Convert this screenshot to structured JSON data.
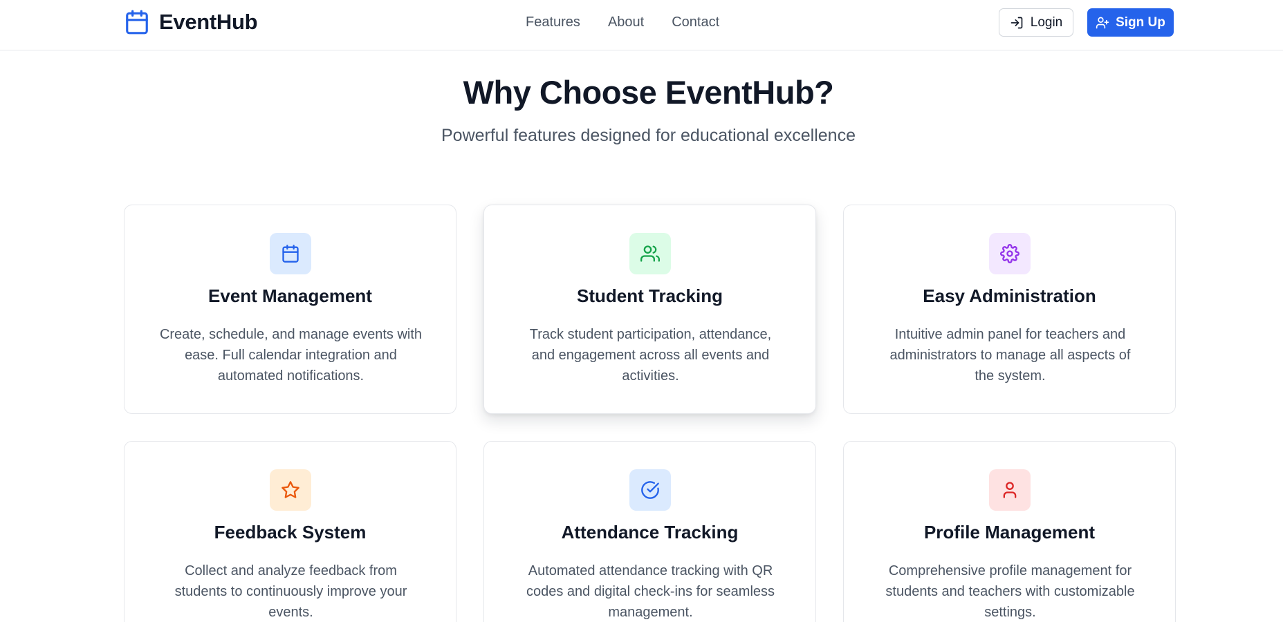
{
  "nav": {
    "brand": "EventHub",
    "links": [
      "Features",
      "About",
      "Contact"
    ],
    "login_label": "Login",
    "signup_label": "Sign Up"
  },
  "hero": {
    "title": "Why Choose EventHub?",
    "subtitle": "Powerful features designed for educational excellence"
  },
  "colors": {
    "primary": "#2563eb",
    "text": "#111827",
    "muted": "#4b5563"
  },
  "features": [
    {
      "title": "Event Management",
      "description": "Create, schedule, and manage events with ease. Full calendar integration and automated notifications.",
      "icon": "calendar-icon",
      "icon_color": "#2563eb",
      "icon_bg": "#dbeafe"
    },
    {
      "title": "Student Tracking",
      "description": "Track student participation, attendance, and engagement across all events and activities.",
      "icon": "users-icon",
      "icon_color": "#16a34a",
      "icon_bg": "#dcfce7"
    },
    {
      "title": "Easy Administration",
      "description": "Intuitive admin panel for teachers and administrators to manage all aspects of the system.",
      "icon": "gear-icon",
      "icon_color": "#9333ea",
      "icon_bg": "#f3e8ff"
    },
    {
      "title": "Feedback System",
      "description": "Collect and analyze feedback from students to continuously improve your events.",
      "icon": "star-icon",
      "icon_color": "#ea580c",
      "icon_bg": "#ffedd5"
    },
    {
      "title": "Attendance Tracking",
      "description": "Automated attendance tracking with QR codes and digital check-ins for seamless management.",
      "icon": "check-circle-icon",
      "icon_color": "#2563eb",
      "icon_bg": "#dbeafe"
    },
    {
      "title": "Profile Management",
      "description": "Comprehensive profile management for students and teachers with customizable settings.",
      "icon": "user-icon",
      "icon_color": "#dc2626",
      "icon_bg": "#fee2e2"
    }
  ]
}
